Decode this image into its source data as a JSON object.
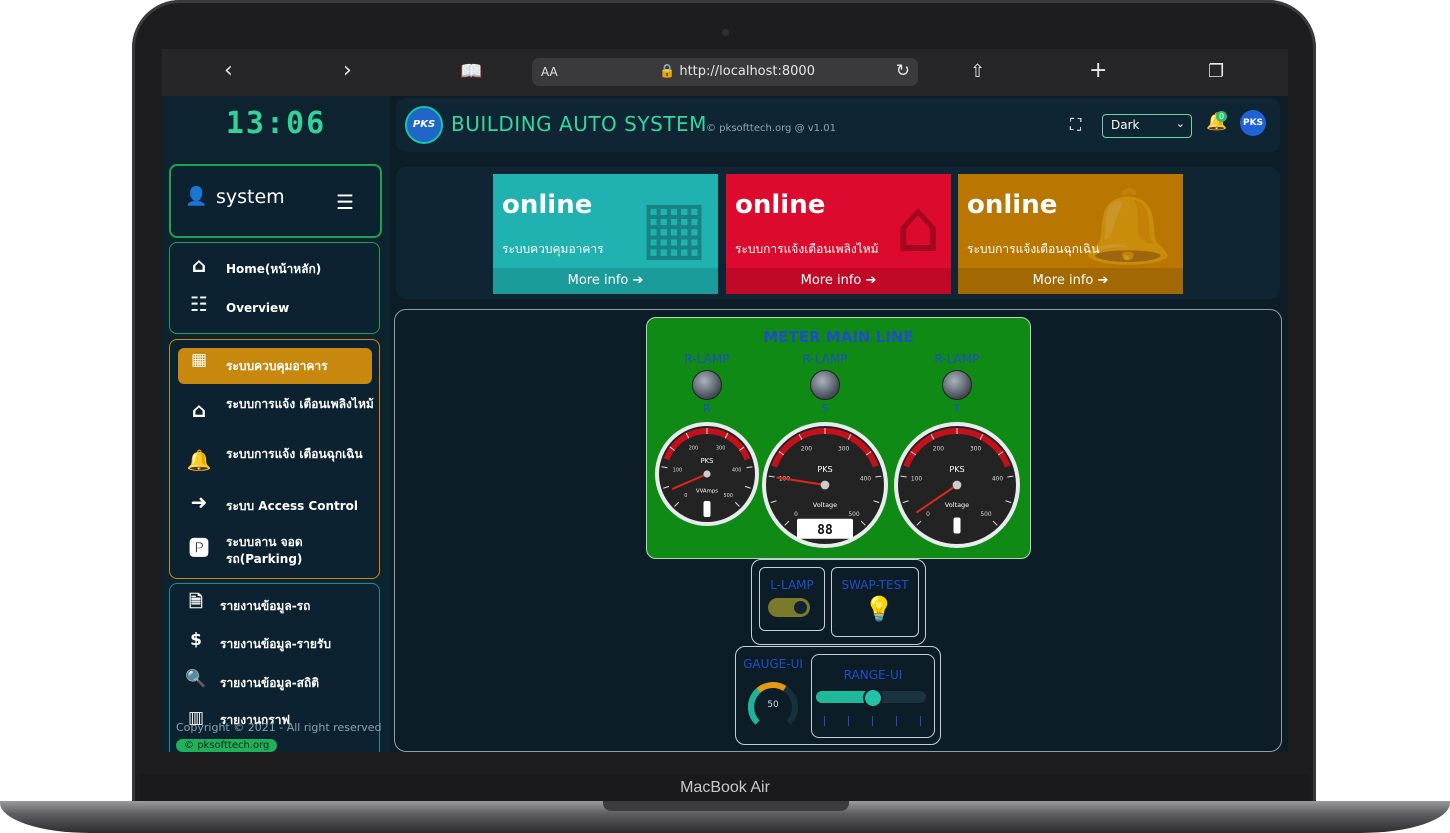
{
  "device": {
    "label": "MacBook Air"
  },
  "browser": {
    "back_icon": "chevron-left-icon",
    "forward_icon": "chevron-right-icon",
    "reader_label": "AA",
    "url": "http://localhost:8000"
  },
  "sidebar": {
    "clock": "13:06",
    "user_name": "system",
    "groups": [
      {
        "items": [
          {
            "icon": "home-icon",
            "label": "Home(หน้าหลัก)"
          },
          {
            "icon": "list-icon",
            "label": "Overview"
          }
        ]
      },
      {
        "items": [
          {
            "icon": "building-shield-icon",
            "label": "ระบบควบคุมอาคาร",
            "active": true
          },
          {
            "icon": "house-fire-icon",
            "label": "ระบบการแจ้ง เตือนเพลิงไหม้"
          },
          {
            "icon": "bell-icon",
            "label": "ระบบการแจ้ง เตือนฉุกเฉิน"
          },
          {
            "icon": "sign-in-icon",
            "label": "ระบบ Access Control"
          },
          {
            "icon": "parking-icon",
            "label": "ระบบลาน จอดรถ(Parking)"
          }
        ]
      },
      {
        "items": [
          {
            "icon": "file-p-icon",
            "label": "รายงานข้อมูล-รถ"
          },
          {
            "icon": "file-dollar-icon",
            "label": "รายงานข้อมูล-รายรับ"
          },
          {
            "icon": "search-chart-icon",
            "label": "รายงานข้อมูล-สถิติ"
          },
          {
            "icon": "bar-chart-icon",
            "label": "รายงานกราฟ"
          }
        ]
      }
    ],
    "copyright": "Copyright © 2021 - All right reserved",
    "copyright_site": "pksofttech.org"
  },
  "header": {
    "logo_text": "PKS",
    "title": "BUILDING AUTO SYSTEM",
    "subtitle": "© pksofttech.org @ v1.01",
    "theme": "Dark",
    "notification_count": "0",
    "avatar": "PKS"
  },
  "cards": [
    {
      "status": "online",
      "desc": "ระบบควบคุมอาคาร",
      "more": "More info ➔",
      "color": "#1fb2b0",
      "icon": "building-shield-icon"
    },
    {
      "status": "online",
      "desc": "ระบบการแจ้งเตือนเพลิงไหม้",
      "more": "More info ➔",
      "color": "#dc0a2c",
      "icon": "house-fire-icon"
    },
    {
      "status": "online",
      "desc": "ระบบการแจ้งเตือนฉุกเฉิน",
      "more": "More info ➔",
      "color": "#b97702",
      "icon": "bell-icon"
    }
  ],
  "meter": {
    "title": "METER MAIN LINE",
    "lamps": [
      {
        "label": "R-LAMP",
        "phase": "R"
      },
      {
        "label": "R-LAMP",
        "phase": "S"
      },
      {
        "label": "R-LAMP",
        "phase": "T"
      }
    ],
    "gauges": [
      {
        "brand": "PKS",
        "unit": "VVAmps",
        "max": 500,
        "value": 40,
        "readout": ""
      },
      {
        "brand": "PKS",
        "unit": "Voltage",
        "max": 500,
        "value": 100,
        "readout": "88"
      },
      {
        "brand": "PKS",
        "unit": "Voltage",
        "max": 500,
        "value": 20,
        "readout": ""
      }
    ]
  },
  "controls": {
    "l_lamp_label": "L-LAMP",
    "l_lamp_on": true,
    "swap_label": "SWAP-TEST",
    "gauge_label": "GAUGE-UI",
    "gauge_value": "50",
    "gauge_fraction": 0.62,
    "range_label": "RANGE-UI",
    "range_fraction": 0.5
  }
}
